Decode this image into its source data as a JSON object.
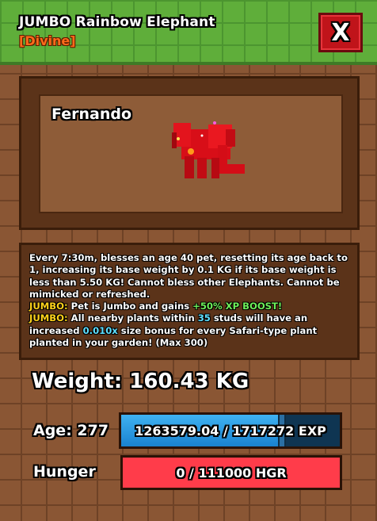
{
  "header": {
    "title": "JUMBO Rainbow Elephant",
    "rarity": "[Divine]",
    "close_label": "X"
  },
  "pet": {
    "name": "Fernando",
    "icon": "red-elephant-icon",
    "color": "#e0101a"
  },
  "description": {
    "line1": "Every 7:30m, blesses an age 40 pet, resetting its age back to 1, increasing its base weight by 0.1 KG if its base weight is less than 5.50 KG! Cannot bless other Elephants. Cannot be mimicked or refreshed.",
    "jumbo1_tag": "JUMBO:",
    "jumbo1_text": " Pet is Jumbo and gains ",
    "jumbo1_boost": "+50% XP BOOST!",
    "jumbo2_tag": "JUMBO:",
    "jumbo2_text_a": " All nearby plants within ",
    "jumbo2_studs": "35",
    "jumbo2_text_b": " studs will have an increased ",
    "jumbo2_mult": "0.010x",
    "jumbo2_text_c": " size bonus for every Safari-type plant planted in your garden! (Max 300)"
  },
  "stats": {
    "weight_text": "Weight: 160.43 KG",
    "age_label": "Age: 277",
    "exp_text": "1263579.04 / 1717272 EXP",
    "exp_fraction": 0.7358,
    "hunger_label": "Hunger",
    "hunger_text": "0 / 111000 HGR"
  },
  "colors": {
    "rarity": "#ff6a1a",
    "accent_yellow": "#ffd21a",
    "accent_green": "#6ef05a",
    "accent_cyan": "#5ee0ff",
    "exp_bar": "#3fb2f2",
    "hunger_bar": "#ff3c4a",
    "close_button": "#c0141a"
  }
}
